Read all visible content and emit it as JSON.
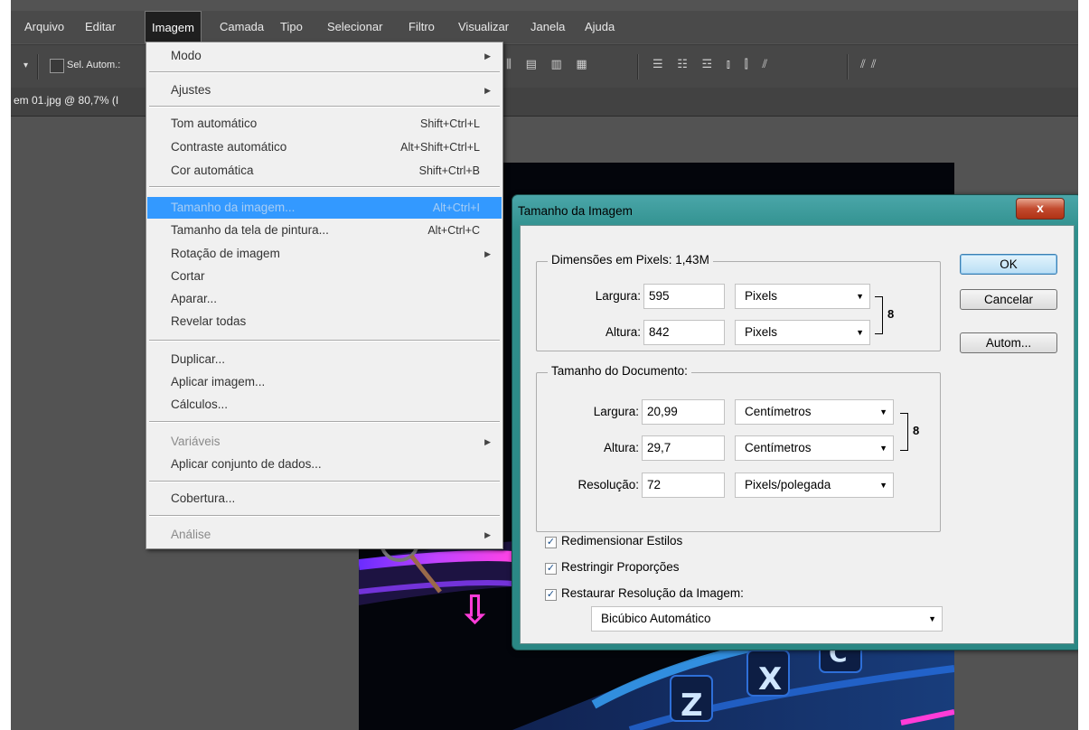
{
  "menubar": {
    "items": [
      "Arquivo",
      "Editar",
      "Imagem",
      "Camada",
      "Tipo",
      "Selecionar",
      "Filtro",
      "Visualizar",
      "Janela",
      "Ajuda"
    ],
    "active": "Imagem"
  },
  "options_bar": {
    "dropdown_arrow": "▾",
    "auto_select_label": "Sel. Autom.:",
    "align_group_1": "⫼ ▤ ▥ ▦",
    "align_group_2": "☰ ☷ ☲ ⫾ ⫿ ⫽",
    "align_group_3": "⫽⫽"
  },
  "document_tab": {
    "label": "em 01.jpg @ 80,7% (I"
  },
  "image_menu": {
    "items": [
      {
        "label": "Modo",
        "shortcut": "",
        "submenu": true,
        "disabled": false
      },
      {
        "label": "Ajustes",
        "shortcut": "",
        "submenu": true,
        "disabled": false
      },
      {
        "label": "Tom automático",
        "shortcut": "Shift+Ctrl+L",
        "submenu": false,
        "disabled": false
      },
      {
        "label": "Contraste automático",
        "shortcut": "Alt+Shift+Ctrl+L",
        "submenu": false,
        "disabled": false
      },
      {
        "label": "Cor automática",
        "shortcut": "Shift+Ctrl+B",
        "submenu": false,
        "disabled": false
      },
      {
        "label": "Tamanho da imagem...",
        "shortcut": "Alt+Ctrl+I",
        "submenu": false,
        "disabled": false,
        "highlighted": true
      },
      {
        "label": "Tamanho da tela de pintura...",
        "shortcut": "Alt+Ctrl+C",
        "submenu": false,
        "disabled": false
      },
      {
        "label": "Rotação de imagem",
        "shortcut": "",
        "submenu": true,
        "disabled": false
      },
      {
        "label": "Cortar",
        "shortcut": "",
        "submenu": false,
        "disabled": false
      },
      {
        "label": "Aparar...",
        "shortcut": "",
        "submenu": false,
        "disabled": false
      },
      {
        "label": "Revelar todas",
        "shortcut": "",
        "submenu": false,
        "disabled": false
      },
      {
        "label": "Duplicar...",
        "shortcut": "",
        "submenu": false,
        "disabled": false
      },
      {
        "label": "Aplicar imagem...",
        "shortcut": "",
        "submenu": false,
        "disabled": false
      },
      {
        "label": "Cálculos...",
        "shortcut": "",
        "submenu": false,
        "disabled": false
      },
      {
        "label": "Variáveis",
        "shortcut": "",
        "submenu": true,
        "disabled": true
      },
      {
        "label": "Aplicar conjunto de dados...",
        "shortcut": "",
        "submenu": false,
        "disabled": false
      },
      {
        "label": "Cobertura...",
        "shortcut": "",
        "submenu": false,
        "disabled": false
      },
      {
        "label": "Análise",
        "shortcut": "",
        "submenu": true,
        "disabled": true
      }
    ]
  },
  "dialog": {
    "title": "Tamanho da Imagem",
    "close_glyph": "x",
    "pixel_dimensions": {
      "title": "Dimensões em Pixels: 1,43M",
      "width_label": "Largura:",
      "width_value": "595",
      "width_unit": "Pixels",
      "height_label": "Altura:",
      "height_value": "842",
      "height_unit": "Pixels"
    },
    "document_size": {
      "title": "Tamanho do Documento:",
      "width_label": "Largura:",
      "width_value": "20,99",
      "width_unit": "Centímetros",
      "height_label": "Altura:",
      "height_value": "29,7",
      "height_unit": "Centímetros",
      "resolution_label": "Resolução:",
      "resolution_value": "72",
      "resolution_unit": "Pixels/polegada"
    },
    "chain_glyph": "8",
    "checkboxes": [
      {
        "label": "Redimensionar Estilos",
        "checked": true
      },
      {
        "label": "Restringir Proporções",
        "checked": true
      },
      {
        "label": "Restaurar Resolução da Imagem:",
        "checked": true
      }
    ],
    "check_glyph": "✓",
    "caret_glyph": "▼",
    "resample_method": "Bicúbico Automático",
    "buttons": {
      "ok": "OK",
      "cancel": "Cancelar",
      "auto": "Autom..."
    }
  },
  "colors": {
    "app_bg": "#535353",
    "menu_highlight": "#3399ff",
    "dialog_frame": "#2f8f8c",
    "neon_pink": "#ff3cd8",
    "neon_purple": "#a24bff",
    "neon_blue": "#2aa0ff"
  },
  "canvas_image": {
    "key_letters": [
      "Z",
      "X",
      "C"
    ],
    "arrow_glyph": "⇩"
  }
}
